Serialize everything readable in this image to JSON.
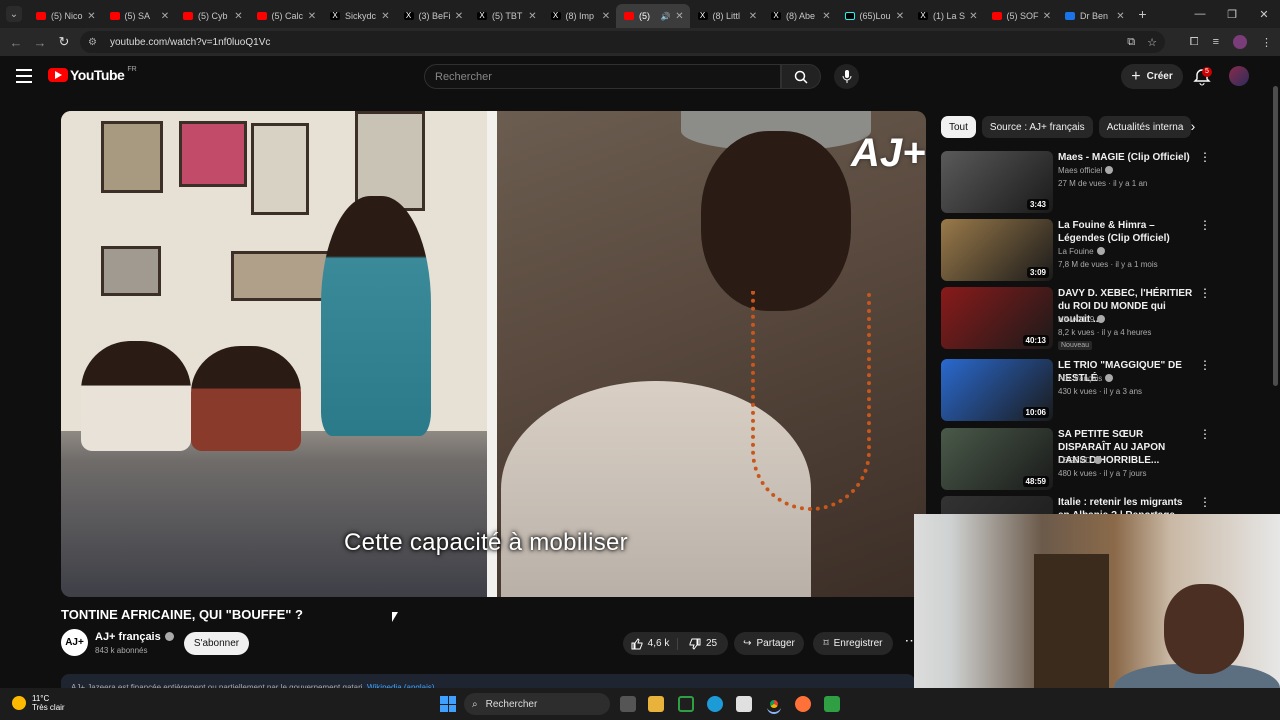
{
  "browser": {
    "tabs": [
      {
        "title": "(5) Nico",
        "icon": "youtube-icon"
      },
      {
        "title": "(5) SA",
        "icon": "youtube-icon"
      },
      {
        "title": "(5) Cyb",
        "icon": "youtube-icon"
      },
      {
        "title": "(5) Calc",
        "icon": "youtube-icon"
      },
      {
        "title": "Sickydc",
        "icon": "x-icon"
      },
      {
        "title": "(3) BeFi",
        "icon": "x-icon"
      },
      {
        "title": "(5) TBT",
        "icon": "x-icon"
      },
      {
        "title": "(8) Imp",
        "icon": "x-icon"
      },
      {
        "title": "(5)",
        "icon": "youtube-icon",
        "active": true
      },
      {
        "title": "(8) Littl",
        "icon": "x-icon"
      },
      {
        "title": "(8) Abe",
        "icon": "x-icon"
      },
      {
        "title": "(65)Lou",
        "icon": "tiktok-icon"
      },
      {
        "title": "(1) La S",
        "icon": "x-icon"
      },
      {
        "title": "(5) SOF",
        "icon": "youtube-icon"
      },
      {
        "title": "Dr Ben",
        "icon": "doc-icon"
      }
    ],
    "url": "youtube.com/watch?v=1nf0luoQ1Vc"
  },
  "youtube": {
    "logo_text": "YouTube",
    "country_code": "FR",
    "search_placeholder": "Rechercher",
    "create_label": "Créer",
    "notification_count": "5"
  },
  "video": {
    "caption": "Cette capacité à mobiliser",
    "title": "TONTINE AFRICAINE, QUI \"BOUFFE\" ?",
    "channel": "AJ+ français",
    "subscribers": "843 k abonnés",
    "subscribe_label": "S'abonner",
    "likes": "4,6 k",
    "dislikes": "25",
    "share_label": "Partager",
    "save_label": "Enregistrer",
    "banner_text": "AJ+ Jazeera est financée entièrement ou partiellement par le gouvernement qatari.",
    "banner_link": "Wikipedia (anglais)"
  },
  "chips": [
    "Tout",
    "Source : AJ+ français",
    "Actualités interna"
  ],
  "recommendations": [
    {
      "title": "Maes - MAGIE (Clip Officiel)",
      "channel": "Maes officiel",
      "meta": "27 M de vues · il y a 1 an",
      "duration": "3:43",
      "color": "#5a5a5a"
    },
    {
      "title": "La Fouine & Himra – Légendes (Clip Officiel)",
      "channel": "La Fouine",
      "meta": "7,8 M de vues · il y a 1 mois",
      "duration": "3:09",
      "color": "#9a7a4a"
    },
    {
      "title": "DAVY D. XEBEC, l'HÉRITIER du ROI DU MONDE qui voulait ...",
      "channel": "NINA2119",
      "meta": "8,2 k vues · il y a 4 heures",
      "duration": "40:13",
      "badge": "Nouveau",
      "color": "#8a1a1a"
    },
    {
      "title": "LE TRIO \"MAGGIQUE\" DE NESTLÉ",
      "channel": "AJ+ français",
      "meta": "430 k vues · il y a 3 ans",
      "duration": "10:06",
      "color": "#2a6ad0"
    },
    {
      "title": "SA PETITE SŒUR DISPARAÎT AU JAPON DANS D'HORRIBLE...",
      "channel": "LEGEND",
      "meta": "480 k vues · il y a 7 jours",
      "duration": "48:59",
      "color": "#4a5a4a"
    },
    {
      "title": "Italie : retenir les migrants en Albanie ? | Reportage 2025 |",
      "channel": "",
      "meta": "",
      "duration": "",
      "color": "#333333"
    }
  ],
  "taskbar": {
    "temperature": "11°C",
    "weather": "Très clair",
    "search_label": "Rechercher"
  }
}
